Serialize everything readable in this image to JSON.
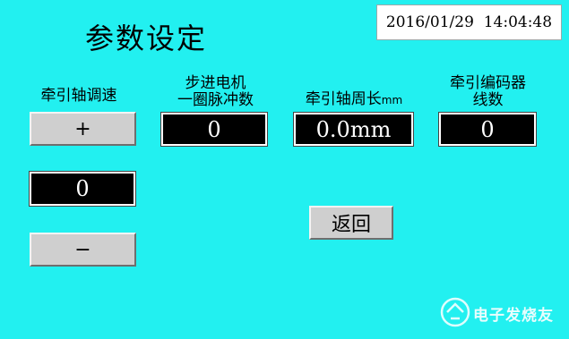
{
  "header": {
    "title": "参数设定",
    "datetime": "2016/01/29  14:04:48"
  },
  "traction_speed": {
    "label": "牵引轴调速",
    "plus_label": "+",
    "value": "0",
    "minus_label": "−"
  },
  "stepper_pulses": {
    "label_line1": "步进电机",
    "label_line2": "一圈脉冲数",
    "value": "0"
  },
  "traction_circumference": {
    "label": "牵引轴周长",
    "unit": "mm",
    "value": "0.0mm"
  },
  "encoder_lines": {
    "label_line1": "牵引编码器",
    "label_line2": "线数",
    "value": "0"
  },
  "back_button": {
    "label": "返回"
  },
  "watermark": {
    "text": "电子发烧友"
  },
  "colors": {
    "background": "#22F0F0",
    "display_bg": "#000000",
    "button_bg": "#CFCFCF"
  }
}
